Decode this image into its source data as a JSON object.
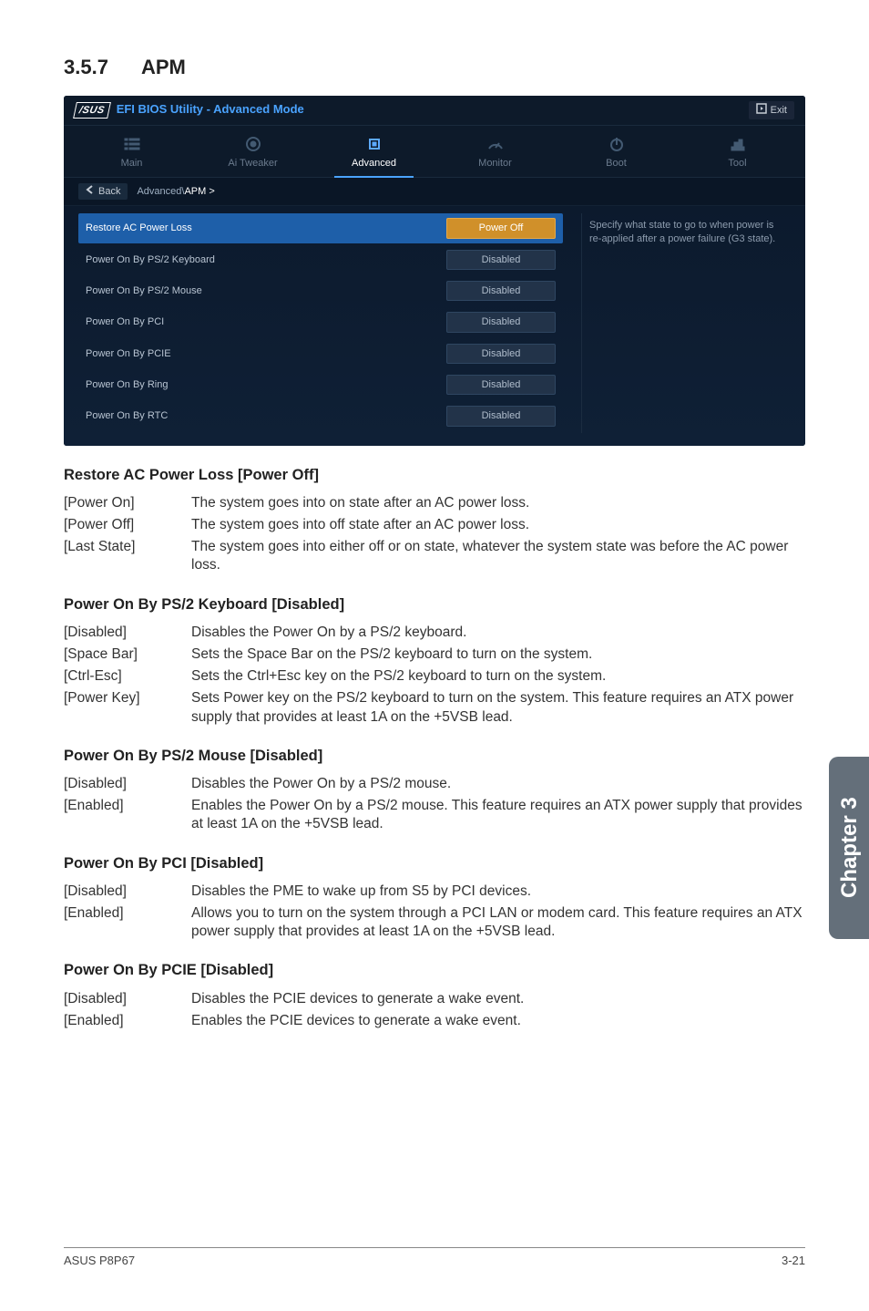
{
  "heading": {
    "number": "3.5.7",
    "title": "APM"
  },
  "bios": {
    "titlebar": {
      "logo": "/SUS",
      "title": "EFI BIOS Utility - Advanced Mode",
      "exit": "Exit"
    },
    "tabs": [
      {
        "label": "Main"
      },
      {
        "label": "Ai  Tweaker"
      },
      {
        "label": "Advanced"
      },
      {
        "label": "Monitor"
      },
      {
        "label": "Boot"
      },
      {
        "label": "Tool"
      }
    ],
    "breadcrumb": {
      "back": "Back",
      "path_prefix": "Advanced\\",
      "path_current": "APM  >"
    },
    "rows": [
      {
        "label": "Restore AC Power Loss",
        "value": "Power Off",
        "active": true
      },
      {
        "label": "Power On By PS/2 Keyboard",
        "value": "Disabled",
        "active": false
      },
      {
        "label": "Power On By PS/2 Mouse",
        "value": "Disabled",
        "active": false
      },
      {
        "label": "Power On By PCI",
        "value": "Disabled",
        "active": false
      },
      {
        "label": "Power On By PCIE",
        "value": "Disabled",
        "active": false
      },
      {
        "label": "Power On By Ring",
        "value": "Disabled",
        "active": false
      },
      {
        "label": "Power On By RTC",
        "value": "Disabled",
        "active": false
      }
    ],
    "help": "Specify what state to go to when power is re-applied after a power failure (G3 state)."
  },
  "sections": [
    {
      "title": "Restore AC Power Loss [Power Off]",
      "items": [
        {
          "term": "[Power On]",
          "desc": "The system goes into on state after an AC power loss."
        },
        {
          "term": "[Power Off]",
          "desc": "The system goes into off state after an AC power loss."
        },
        {
          "term": "[Last State]",
          "desc": "The system goes into either off or on state, whatever the system state was before the AC power loss."
        }
      ]
    },
    {
      "title": "Power On By PS/2 Keyboard [Disabled]",
      "items": [
        {
          "term": "[Disabled]",
          "desc": "Disables the Power On by a PS/2 keyboard."
        },
        {
          "term": "[Space Bar]",
          "desc": "Sets the Space Bar on the PS/2 keyboard to turn on the system."
        },
        {
          "term": "[Ctrl-Esc]",
          "desc": "Sets the Ctrl+Esc key on the PS/2 keyboard to turn on the system."
        },
        {
          "term": "[Power Key]",
          "desc": "Sets Power key on the PS/2 keyboard to turn on the system. This feature requires an ATX power supply that provides at least 1A on the +5VSB lead."
        }
      ]
    },
    {
      "title": "Power On By PS/2 Mouse [Disabled]",
      "items": [
        {
          "term": "[Disabled]",
          "desc": "Disables the Power On by a PS/2 mouse."
        },
        {
          "term": "[Enabled]",
          "desc": "Enables the Power On by a PS/2 mouse. This feature requires an ATX power supply that provides at least 1A on the +5VSB lead."
        }
      ]
    },
    {
      "title": "Power On By PCI [Disabled]",
      "items": [
        {
          "term": "[Disabled]",
          "desc": "Disables the PME to wake up from S5 by PCI devices."
        },
        {
          "term": "[Enabled]",
          "desc": "Allows you to turn on the system through a PCI LAN or modem card. This feature requires an ATX power supply that provides at least 1A on the +5VSB lead."
        }
      ]
    },
    {
      "title": "Power On By PCIE [Disabled]",
      "items": [
        {
          "term": "[Disabled]",
          "desc": "Disables the PCIE devices to generate a wake event."
        },
        {
          "term": "[Enabled]",
          "desc": "Enables the PCIE devices to generate a wake event."
        }
      ]
    }
  ],
  "chapter_tab": "Chapter 3",
  "footer": {
    "left": "ASUS P8P67",
    "right": "3-21"
  }
}
